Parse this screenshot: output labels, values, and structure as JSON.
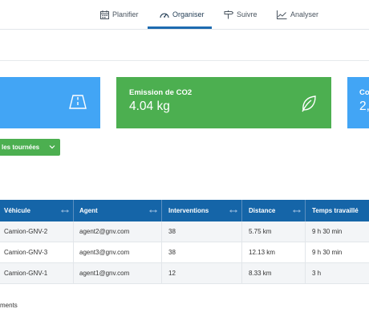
{
  "nav": {
    "items": [
      {
        "label": "Planifier",
        "icon": "calendar-icon"
      },
      {
        "label": "Organiser",
        "icon": "gauge-icon",
        "active": true
      },
      {
        "label": "Suivre",
        "icon": "signpost-icon"
      },
      {
        "label": "Analyser",
        "icon": "chart-icon"
      }
    ]
  },
  "cards": {
    "left": {
      "icon": "road-icon",
      "color": "#42a5f5"
    },
    "co2": {
      "title": "Emission de CO2",
      "value": "4.04 kg",
      "icon": "leaf-icon",
      "color": "#4caf50"
    },
    "right": {
      "title": "Co",
      "value": "2,",
      "color": "#42a5f5"
    }
  },
  "tours_button": {
    "label": "les tournées",
    "icon": "chevron-down-icon",
    "color": "#4caf50"
  },
  "table": {
    "headers": [
      "Véhicule",
      "Agent",
      "Interventions",
      "Distance",
      "Temps travaillé"
    ],
    "rows": [
      [
        "Camion-GNV-2",
        "agent2@gnv.com",
        "38",
        "5.75 km",
        "9 h 30 min"
      ],
      [
        "Camion-GNV-3",
        "agent3@gnv.com",
        "38",
        "12.13 km",
        "9 h 30 min"
      ],
      [
        "Camion-GNV-1",
        "agent1@gnv.com",
        "12",
        "8.33 km",
        "3 h"
      ]
    ],
    "header_color": "#1565a8"
  },
  "footer": {
    "text": "ments"
  }
}
